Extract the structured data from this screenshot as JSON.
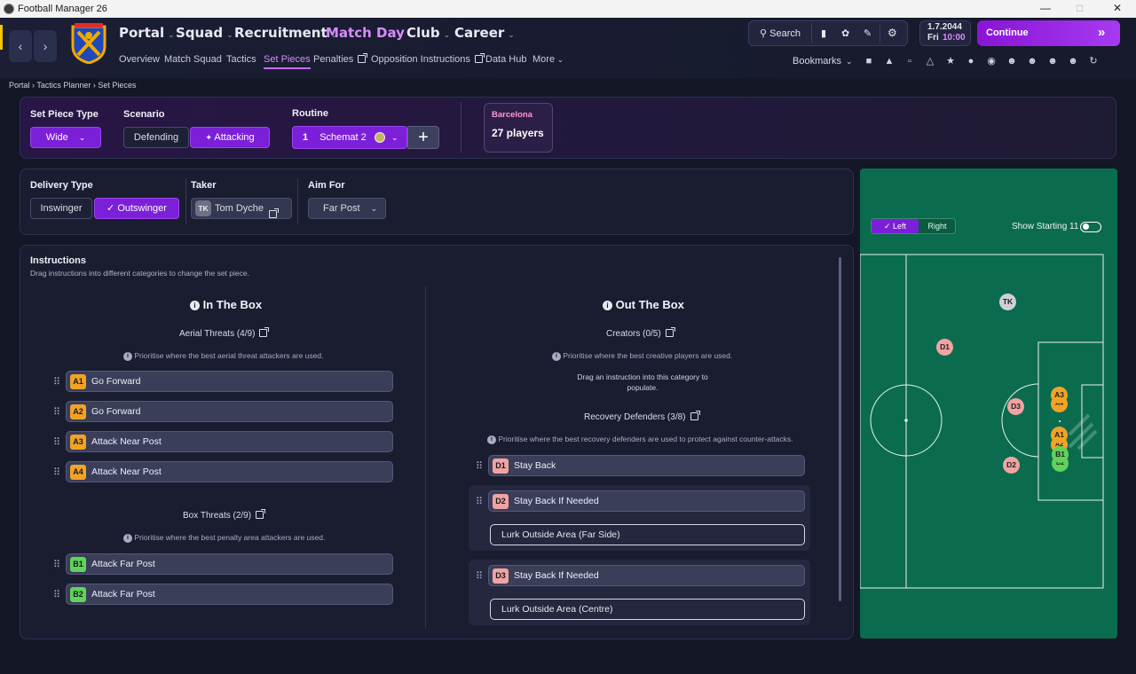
{
  "window": {
    "title": "Football Manager 26"
  },
  "nav": {
    "main": [
      {
        "label": "Portal"
      },
      {
        "label": "Squad"
      },
      {
        "label": "Recruitment"
      },
      {
        "label": "Match Day"
      },
      {
        "label": "Club"
      },
      {
        "label": "Career"
      }
    ],
    "sub": [
      "Overview",
      "Match Squad",
      "Tactics",
      "Set Pieces",
      "Penalties",
      "Opposition Instructions",
      "Data Hub",
      "More"
    ],
    "active_main": "Match Day",
    "active_sub": "Set Pieces"
  },
  "toolbar": {
    "search_label": "Search",
    "date": "1.7.2044",
    "day": "Fri",
    "time": "10:00",
    "continue_label": "Continue",
    "bookmarks_label": "Bookmarks"
  },
  "breadcrumb": [
    "Portal",
    "Tactics Planner",
    "Set Pieces"
  ],
  "setpiece": {
    "type_label": "Set Piece Type",
    "type_value": "Wide",
    "scenario_label": "Scenario",
    "scenario_options": [
      "Defending",
      "Attacking"
    ],
    "scenario_selected": "Attacking",
    "routine_label": "Routine",
    "routine_number": "1",
    "routine_name": "Schemat 2",
    "team_name": "Barcelona",
    "team_players": "27 players"
  },
  "delivery": {
    "label": "Delivery Type",
    "options": [
      "Inswinger",
      "Outswinger"
    ],
    "selected": "Outswinger",
    "taker_label": "Taker",
    "taker_initials": "TK",
    "taker_name": "Tom Dyche",
    "aim_label": "Aim For",
    "aim_value": "Far Post"
  },
  "instructions": {
    "title": "Instructions",
    "subtitle": "Drag instructions into different categories to change the set piece.",
    "in_box": {
      "title": "In The Box",
      "aerial": {
        "label": "Aerial Threats (4/9)",
        "hint": "Prioritise where the best aerial threat attackers are used.",
        "items": [
          {
            "badge": "A1",
            "label": "Go Forward"
          },
          {
            "badge": "A2",
            "label": "Go Forward"
          },
          {
            "badge": "A3",
            "label": "Attack Near Post"
          },
          {
            "badge": "A4",
            "label": "Attack Near Post"
          }
        ]
      },
      "box": {
        "label": "Box Threats (2/9)",
        "hint": "Prioritise where the best penalty area attackers are used.",
        "items": [
          {
            "badge": "B1",
            "label": "Attack Far Post"
          },
          {
            "badge": "B2",
            "label": "Attack Far Post"
          }
        ]
      }
    },
    "out_box": {
      "title": "Out The Box",
      "creators": {
        "label": "Creators (0/5)",
        "hint": "Prioritise where the best creative players are used.",
        "empty": "Drag an instruction into this category to populate."
      },
      "recovery": {
        "label": "Recovery Defenders (3/8)",
        "hint": "Prioritise where the best recovery defenders are used to protect against counter-attacks.",
        "items": [
          {
            "badge": "D1",
            "label": "Stay Back"
          },
          {
            "badge": "D2",
            "label": "Stay Back If Needed",
            "sub": "Lurk Outside Area (Far Side)"
          },
          {
            "badge": "D3",
            "label": "Stay Back If Needed",
            "sub": "Lurk Outside Area (Centre)"
          }
        ]
      }
    }
  },
  "pitch": {
    "side_options": [
      "Left",
      "Right"
    ],
    "side_selected": "Left",
    "show_starting_label": "Show Starting 11",
    "show_starting_on": false,
    "markers": [
      "TK",
      "D1",
      "D2",
      "D3",
      "A3",
      "A4",
      "A1",
      "A2",
      "B1",
      "B2"
    ]
  },
  "colors": {
    "accent": "#8a14d6",
    "aerial": "#f2a326",
    "box": "#5fd35a",
    "recovery": "#f1a3a3",
    "pitch": "#0b6b4e"
  }
}
